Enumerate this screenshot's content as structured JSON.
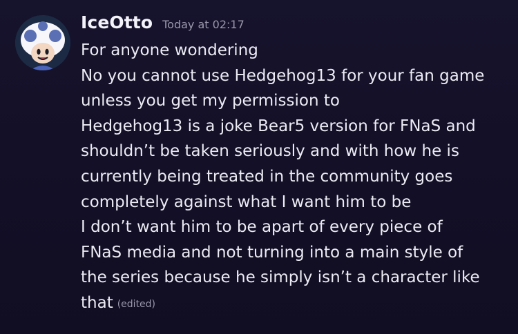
{
  "message": {
    "author": {
      "username": "IceOtto",
      "avatar_icon": "toad-mushroom-avatar-icon"
    },
    "timestamp": "Today at 02:17",
    "lines": [
      "For anyone wondering",
      "No you cannot use Hedgehog13 for your fan game",
      "unless you get my permission to",
      "Hedgehog13 is a joke Bear5 version for FNaS and",
      "shouldn’t be taken seriously and with how he is",
      "currently being treated in the community goes",
      "completely against what I want him to be",
      "I don’t want him to be apart of every piece of",
      "FNaS media and not turning into a main style of",
      "the series because he simply isn’t a character like",
      "that"
    ],
    "edited_label": "(edited)"
  },
  "colors": {
    "background": "#15122a",
    "text": "#ecebf3",
    "muted": "#9b98ad"
  }
}
